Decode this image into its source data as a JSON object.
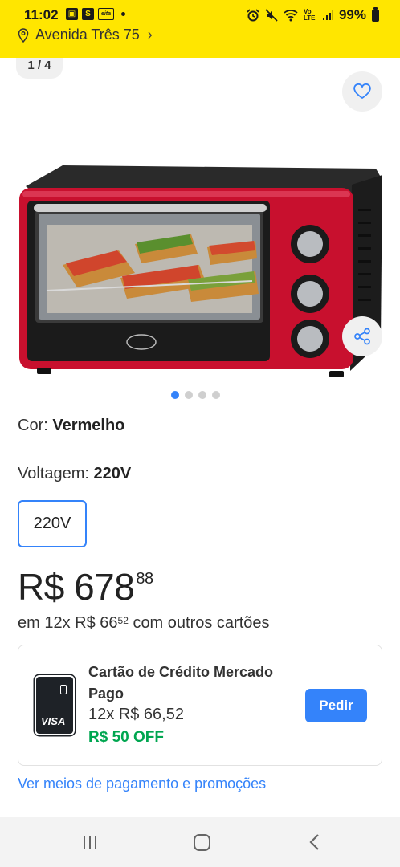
{
  "status_bar": {
    "time": "11:02",
    "left_icons": [
      "image-icon",
      "s-app-icon",
      "eita-app-icon",
      "dot-icon"
    ],
    "s_glyph": "S",
    "eita_glyph": "eita",
    "battery": "99%",
    "network": "Vo LTE"
  },
  "header": {
    "location": "Avenida Três 75",
    "background": "#ffe600"
  },
  "gallery": {
    "counter": "1 / 4",
    "image_count": 4,
    "active_index": 0
  },
  "product": {
    "color_label": "Cor:",
    "color_value": "Vermelho",
    "voltage_label": "Voltagem:",
    "voltage_value": "220V",
    "voltage_options": [
      "220V"
    ],
    "price_currency": "R$",
    "price_integer": "678",
    "price_cents": "88",
    "installments_prefix": "em 12x R$ 66",
    "installments_cents": "52",
    "installments_suffix": "com outros cartões"
  },
  "credit_offer": {
    "title": "Cartão de Crédito Mercado Pago",
    "installments": "12x R$ 66,52",
    "discount": "R$ 50 OFF",
    "button": "Pedir",
    "card_brand": "VISA"
  },
  "payment_link": "Ver meios de pagamento e promoções",
  "colors": {
    "accent": "#3483fa",
    "discount_green": "#00a650",
    "oven_red": "#c8102e"
  }
}
